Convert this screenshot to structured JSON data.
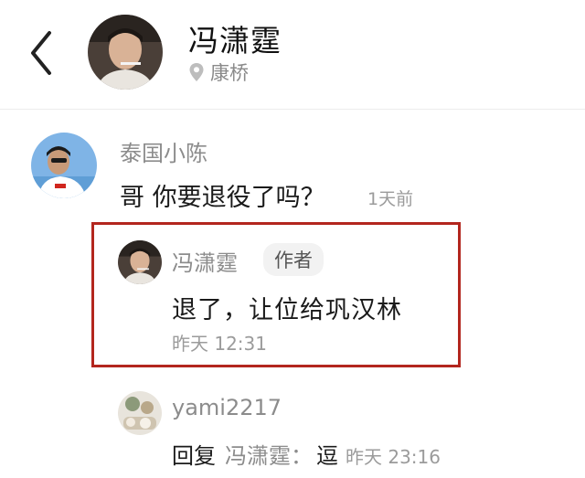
{
  "header": {
    "name": "冯潇霆",
    "location": "康桥"
  },
  "comment": {
    "username": "泰国小陈",
    "text": "哥 你要退役了吗？",
    "time": "1天前"
  },
  "replies": [
    {
      "username": "冯潇霆",
      "badge": "作者",
      "text": "退了，让位给巩汉林",
      "time": "昨天 12:31"
    },
    {
      "username": "yami2217",
      "prefix": "回复",
      "mention": "冯潇霆：",
      "text": "逗",
      "time": "昨天 23:16"
    }
  ],
  "colors": {
    "highlight_border": "#b3261e",
    "secondary_text": "#8c8c8c"
  }
}
